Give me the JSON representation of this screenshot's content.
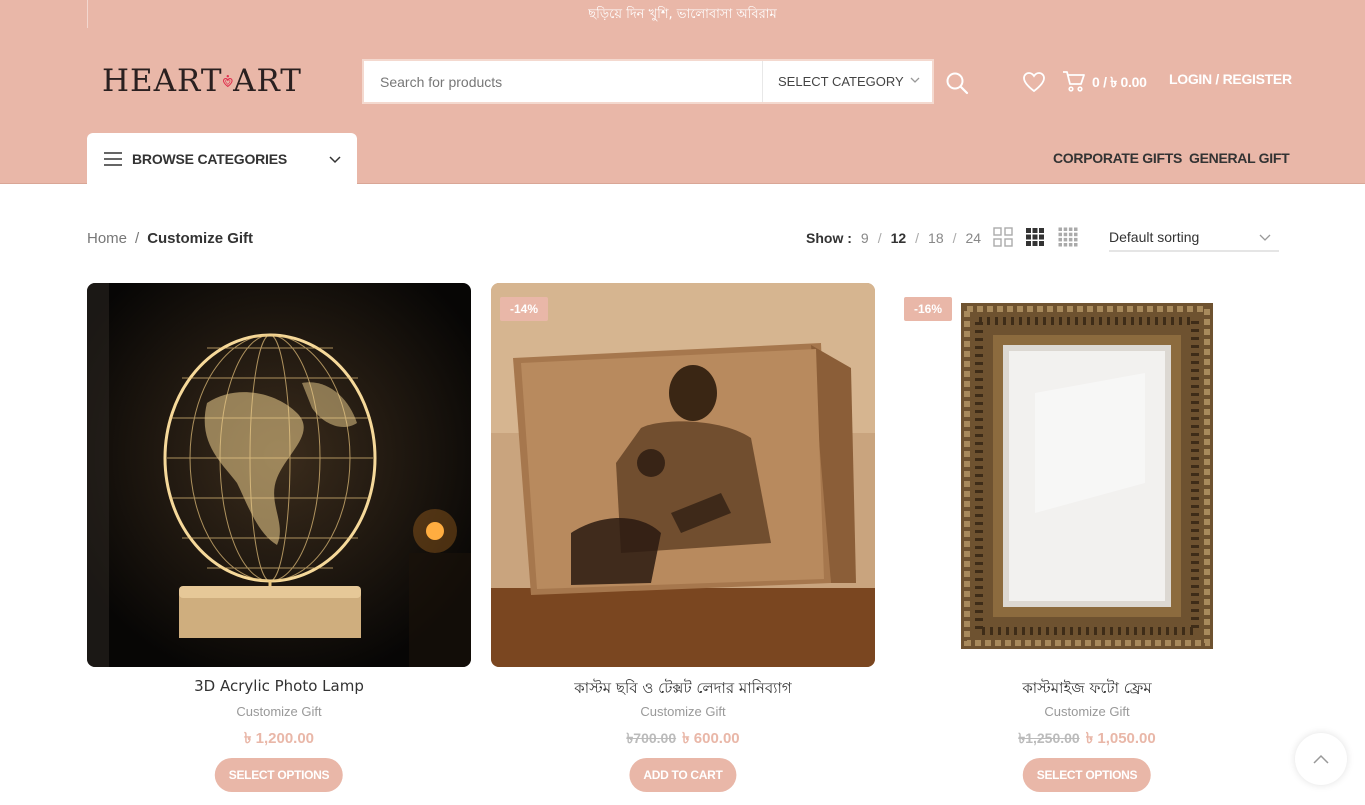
{
  "topbar": {
    "message": "ছড়িয়ে দিন খুশি, ভালোবাসা অবিরাম"
  },
  "logo": {
    "text_left": "HEART",
    "text_right": "ART"
  },
  "search": {
    "placeholder": "Search for products",
    "category_label": "SELECT CATEGORY"
  },
  "header": {
    "cart_total": "0 / ৳ 0.00",
    "login_label": "LOGIN / REGISTER",
    "browse_label": "BROWSE CATEGORIES",
    "nav": [
      "CORPORATE GIFTS",
      "GENERAL GIFT"
    ]
  },
  "breadcrumb": {
    "home": "Home",
    "separator": "/",
    "current": "Customize Gift"
  },
  "toolbar": {
    "show_label": "Show :",
    "show_options": [
      "9",
      "12",
      "18",
      "24"
    ],
    "show_active": "12",
    "sort_label": "Default sorting"
  },
  "products": [
    {
      "title": "3D Acrylic Photo Lamp",
      "category": "Customize Gift",
      "old_price": "",
      "price": "৳ 1,200.00",
      "badge": "",
      "button": "SELECT OPTIONS"
    },
    {
      "title": "কাস্টম ছবি ও টেক্সট লেদার মানিব্যাগ",
      "category": "Customize Gift",
      "old_price": "৳700.00",
      "price": "৳ 600.00",
      "badge": "-14%",
      "button": "ADD TO CART"
    },
    {
      "title": "কাস্টমাইজ ফটো ফ্রেম",
      "category": "Customize Gift",
      "old_price": "৳1,250.00",
      "price": "৳ 1,050.00",
      "badge": "-16%",
      "button": "SELECT OPTIONS"
    }
  ],
  "colors": {
    "brand": "#e9b7a8",
    "heart": "#e0304e",
    "text": "#333333"
  },
  "icons": [
    "search-icon",
    "heart-icon",
    "cart-icon",
    "menu-icon",
    "chevron-down-icon",
    "grid-2-icon",
    "grid-3-icon",
    "grid-4-icon",
    "chevron-up-icon"
  ]
}
